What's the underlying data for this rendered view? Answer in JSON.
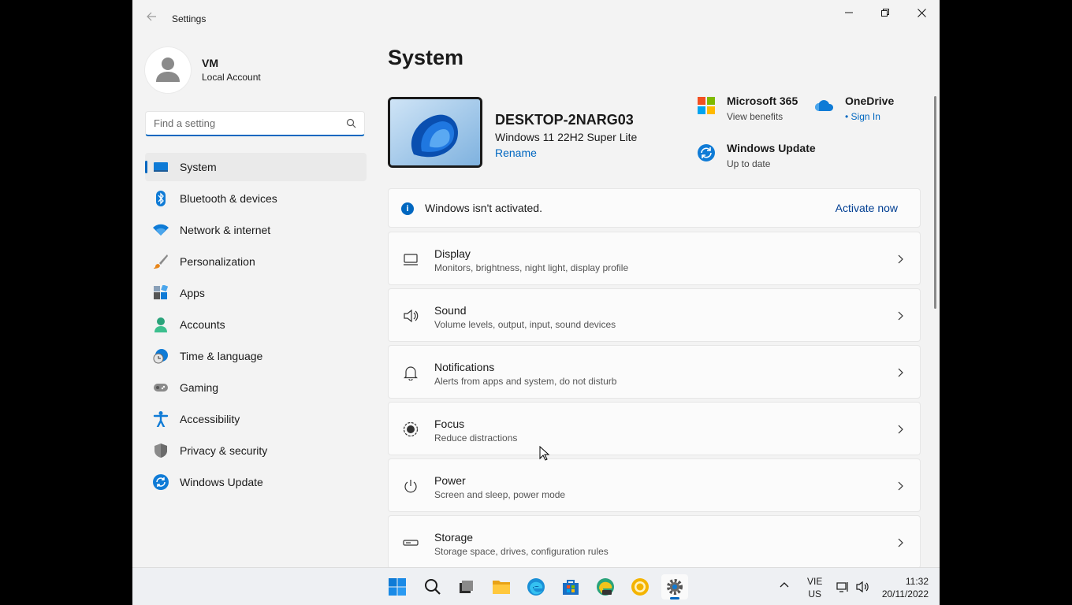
{
  "window": {
    "title": "Settings"
  },
  "profile": {
    "name": "VM",
    "account_type": "Local Account"
  },
  "search": {
    "placeholder": "Find a setting",
    "value": ""
  },
  "nav": {
    "items": [
      {
        "label": "System",
        "icon": "system-icon",
        "active": true
      },
      {
        "label": "Bluetooth & devices",
        "icon": "bluetooth-icon"
      },
      {
        "label": "Network & internet",
        "icon": "wifi-icon"
      },
      {
        "label": "Personalization",
        "icon": "brush-icon"
      },
      {
        "label": "Apps",
        "icon": "apps-icon"
      },
      {
        "label": "Accounts",
        "icon": "accounts-icon"
      },
      {
        "label": "Time & language",
        "icon": "clock-globe-icon"
      },
      {
        "label": "Gaming",
        "icon": "gamepad-icon"
      },
      {
        "label": "Accessibility",
        "icon": "accessibility-icon"
      },
      {
        "label": "Privacy & security",
        "icon": "shield-icon"
      },
      {
        "label": "Windows Update",
        "icon": "update-icon"
      }
    ]
  },
  "main": {
    "title": "System",
    "device": {
      "name": "DESKTOP-2NARG03",
      "os": "Windows 11 22H2 Super Lite",
      "rename_label": "Rename"
    },
    "quick_links": [
      {
        "title": "Microsoft 365",
        "subtitle": "View benefits",
        "icon": "microsoft-logo-icon"
      },
      {
        "title": "OneDrive",
        "subtitle": "• Sign In",
        "icon": "cloud-icon"
      },
      {
        "title": "Windows Update",
        "subtitle": "Up to date",
        "icon": "update-icon"
      }
    ],
    "activation": {
      "message": "Windows isn't activated.",
      "action": "Activate now"
    },
    "settings": [
      {
        "title": "Display",
        "subtitle": "Monitors, brightness, night light, display profile",
        "icon": "monitor-icon"
      },
      {
        "title": "Sound",
        "subtitle": "Volume levels, output, input, sound devices",
        "icon": "speaker-icon"
      },
      {
        "title": "Notifications",
        "subtitle": "Alerts from apps and system, do not disturb",
        "icon": "bell-icon"
      },
      {
        "title": "Focus",
        "subtitle": "Reduce distractions",
        "icon": "focus-icon"
      },
      {
        "title": "Power",
        "subtitle": "Screen and sleep, power mode",
        "icon": "power-icon"
      },
      {
        "title": "Storage",
        "subtitle": "Storage space, drives, configuration rules",
        "icon": "storage-icon"
      }
    ]
  },
  "taskbar": {
    "apps": [
      "start-icon",
      "search-icon",
      "task-view-icon",
      "file-explorer-icon",
      "edge-icon",
      "store-icon",
      "edge-canary-icon",
      "chrome-canary-icon",
      "settings-icon"
    ],
    "language": {
      "line1": "VIE",
      "line2": "US"
    },
    "time": "11:32",
    "date": "20/11/2022"
  },
  "colors": {
    "accent": "#0067c0",
    "background": "#f3f3f3",
    "card": "#fbfbfb"
  }
}
